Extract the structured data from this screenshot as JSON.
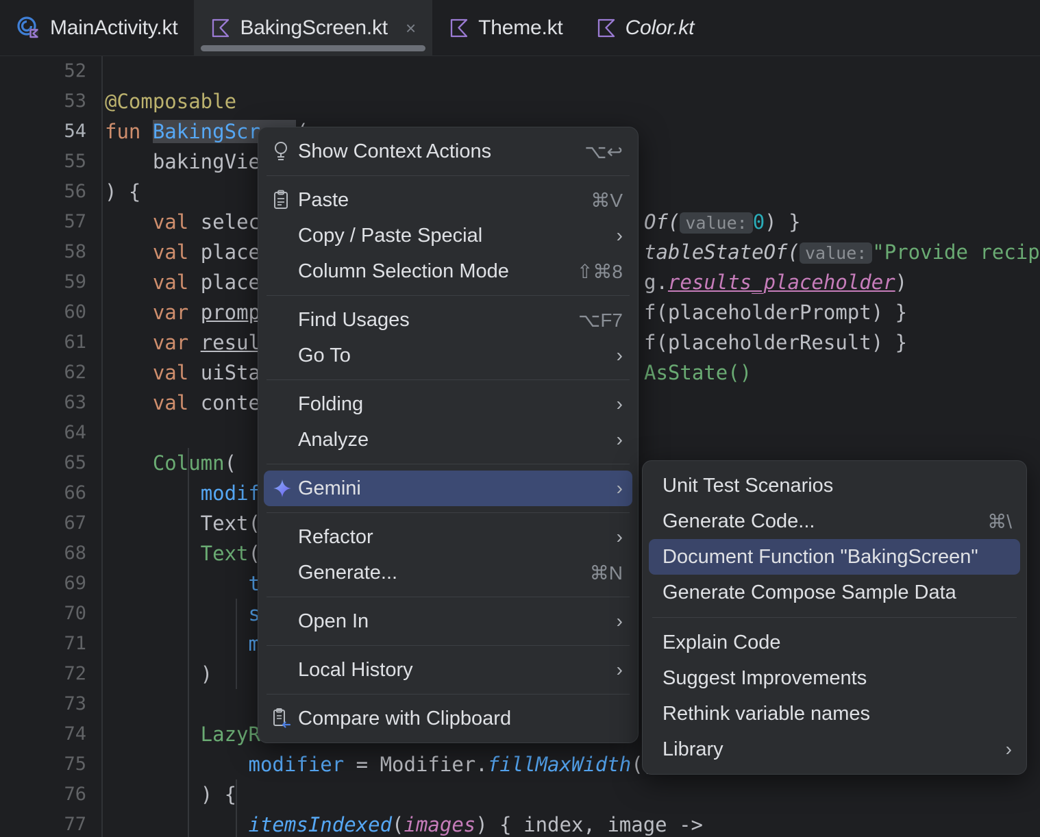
{
  "tabs": [
    {
      "label": "MainActivity.kt",
      "icon": "kotlin-activity-icon",
      "active": false,
      "italic": false,
      "closable": false
    },
    {
      "label": "BakingScreen.kt",
      "icon": "kotlin-file-icon",
      "active": true,
      "italic": false,
      "closable": true,
      "close_glyph": "×"
    },
    {
      "label": "Theme.kt",
      "icon": "kotlin-file-icon",
      "active": false,
      "italic": false,
      "closable": false
    },
    {
      "label": "Color.kt",
      "icon": "kotlin-file-icon",
      "active": false,
      "italic": true,
      "closable": false
    }
  ],
  "editor": {
    "line_numbers": [
      "52",
      "53",
      "54",
      "55",
      "56",
      "57",
      "58",
      "59",
      "60",
      "61",
      "62",
      "63",
      "64",
      "65",
      "66",
      "67",
      "68",
      "69",
      "70",
      "71",
      "72",
      "73",
      "74",
      "75",
      "76",
      "77"
    ],
    "current_line": "54",
    "lines": [
      {
        "n": "52",
        "text": ""
      },
      {
        "n": "53",
        "text": "@Composable"
      },
      {
        "n": "54",
        "text": "fun BakingScreen("
      },
      {
        "n": "55",
        "text": "    bakingView"
      },
      {
        "n": "56",
        "text": ") {"
      },
      {
        "n": "57",
        "text": "    val select"
      },
      {
        "n": "58",
        "text": "    val placeh"
      },
      {
        "n": "59",
        "text": "    val placeh"
      },
      {
        "n": "60",
        "text": "    var prompt"
      },
      {
        "n": "61",
        "text": "    var result"
      },
      {
        "n": "62",
        "text": "    val uiStat"
      },
      {
        "n": "63",
        "text": "    val contex"
      },
      {
        "n": "64",
        "text": ""
      },
      {
        "n": "65",
        "text": "    Column("
      },
      {
        "n": "66",
        "text": "        modifi"
      },
      {
        "n": "67",
        "text": "    ) {"
      },
      {
        "n": "68",
        "text": "        Text("
      },
      {
        "n": "69",
        "text": "            te"
      },
      {
        "n": "70",
        "text": "            st"
      },
      {
        "n": "71",
        "text": "            mo"
      },
      {
        "n": "72",
        "text": "        )"
      },
      {
        "n": "73",
        "text": ""
      },
      {
        "n": "74",
        "text": "        LazyRo"
      },
      {
        "n": "75",
        "text": "            modifier = Modifier.fillMaxWidth()"
      },
      {
        "n": "76",
        "text": "        ) {"
      },
      {
        "n": "77",
        "text": "            itemsIndexed(images) { index, image ->"
      }
    ],
    "right_fragments": {
      "line57": {
        "a": "Of(",
        "hint": "value:",
        "num": "0",
        "b": ") }"
      },
      "line58": {
        "a": "tableStateOf(",
        "hint": "value:",
        "str": "\"Provide recipe of"
      },
      "line59": {
        "a": "g.",
        "ident": "results_placeholder",
        "b": ")"
      },
      "line60": {
        "a": "f(placeholderPrompt) }"
      },
      "line61": {
        "a": "f(placeholderResult) }"
      },
      "line62": {
        "a": "AsState()"
      }
    },
    "line75": {
      "p1": "modifier",
      "p2": " = ",
      "p3": "Modifier.",
      "p4": "fillMaxWidth",
      "p5": "()"
    },
    "line76": {
      "p1": ") {"
    },
    "line77": {
      "p1": "itemsIndexed",
      "p2": "(",
      "p3": "images",
      "p4": ") { index, image ->"
    },
    "selected_token": "BakingScreen"
  },
  "context_menu": {
    "groups": [
      {
        "items": [
          {
            "label": "Show Context Actions",
            "accel": "⌥↩",
            "icon": "lightbulb-icon",
            "arrow": false,
            "selected": false
          }
        ]
      },
      {
        "items": [
          {
            "label": "Paste",
            "accel": "⌘V",
            "icon": "clipboard-paste-icon",
            "arrow": false,
            "selected": false
          },
          {
            "label": "Copy / Paste Special",
            "accel": "",
            "icon": "",
            "arrow": true,
            "selected": false
          },
          {
            "label": "Column Selection Mode",
            "accel": "⇧⌘8",
            "icon": "",
            "arrow": false,
            "selected": false
          }
        ]
      },
      {
        "items": [
          {
            "label": "Find Usages",
            "accel": "⌥F7",
            "icon": "",
            "arrow": false,
            "selected": false
          },
          {
            "label": "Go To",
            "accel": "",
            "icon": "",
            "arrow": true,
            "selected": false
          }
        ]
      },
      {
        "items": [
          {
            "label": "Folding",
            "accel": "",
            "icon": "",
            "arrow": true,
            "selected": false
          },
          {
            "label": "Analyze",
            "accel": "",
            "icon": "",
            "arrow": true,
            "selected": false
          }
        ]
      },
      {
        "items": [
          {
            "label": "Gemini",
            "accel": "",
            "icon": "gemini-sparkle-icon",
            "arrow": true,
            "selected": true
          }
        ]
      },
      {
        "items": [
          {
            "label": "Refactor",
            "accel": "",
            "icon": "",
            "arrow": true,
            "selected": false
          },
          {
            "label": "Generate...",
            "accel": "⌘N",
            "icon": "",
            "arrow": false,
            "selected": false
          }
        ]
      },
      {
        "items": [
          {
            "label": "Open In",
            "accel": "",
            "icon": "",
            "arrow": true,
            "selected": false
          }
        ]
      },
      {
        "items": [
          {
            "label": "Local History",
            "accel": "",
            "icon": "",
            "arrow": true,
            "selected": false
          }
        ]
      },
      {
        "items": [
          {
            "label": "Compare with Clipboard",
            "accel": "",
            "icon": "compare-clipboard-icon",
            "arrow": false,
            "selected": false
          }
        ]
      }
    ]
  },
  "gemini_submenu": {
    "groups": [
      {
        "items": [
          {
            "label": "Unit Test Scenarios",
            "accel": "",
            "arrow": false,
            "selected": false
          },
          {
            "label": "Generate Code...",
            "accel": "⌘\\",
            "arrow": false,
            "selected": false
          },
          {
            "label": "Document Function \"BakingScreen\"",
            "accel": "",
            "arrow": false,
            "selected": true
          },
          {
            "label": "Generate Compose Sample Data",
            "accel": "",
            "arrow": false,
            "selected": false
          }
        ]
      },
      {
        "items": [
          {
            "label": "Explain Code",
            "accel": "",
            "arrow": false,
            "selected": false
          },
          {
            "label": "Suggest Improvements",
            "accel": "",
            "arrow": false,
            "selected": false
          },
          {
            "label": "Rethink variable names",
            "accel": "",
            "arrow": false,
            "selected": false
          },
          {
            "label": "Library",
            "accel": "",
            "arrow": true,
            "selected": false
          }
        ]
      }
    ]
  },
  "colors": {
    "editor_bg": "#1e1f22",
    "tab_active_bg": "#2b2d30",
    "menu_bg": "#2b2d30",
    "menu_highlight": "#3c4a73",
    "submenu_highlight": "#3a4569",
    "keyword": "#cf8e6d",
    "string": "#6aab73",
    "function": "#56a8f5",
    "annotation": "#bcb26e",
    "number": "#2aacb8",
    "identifier_pink": "#c77dbb",
    "text": "#bcbec4",
    "line_number": "#616366",
    "kotlin_icon": "#9b7bd4"
  }
}
